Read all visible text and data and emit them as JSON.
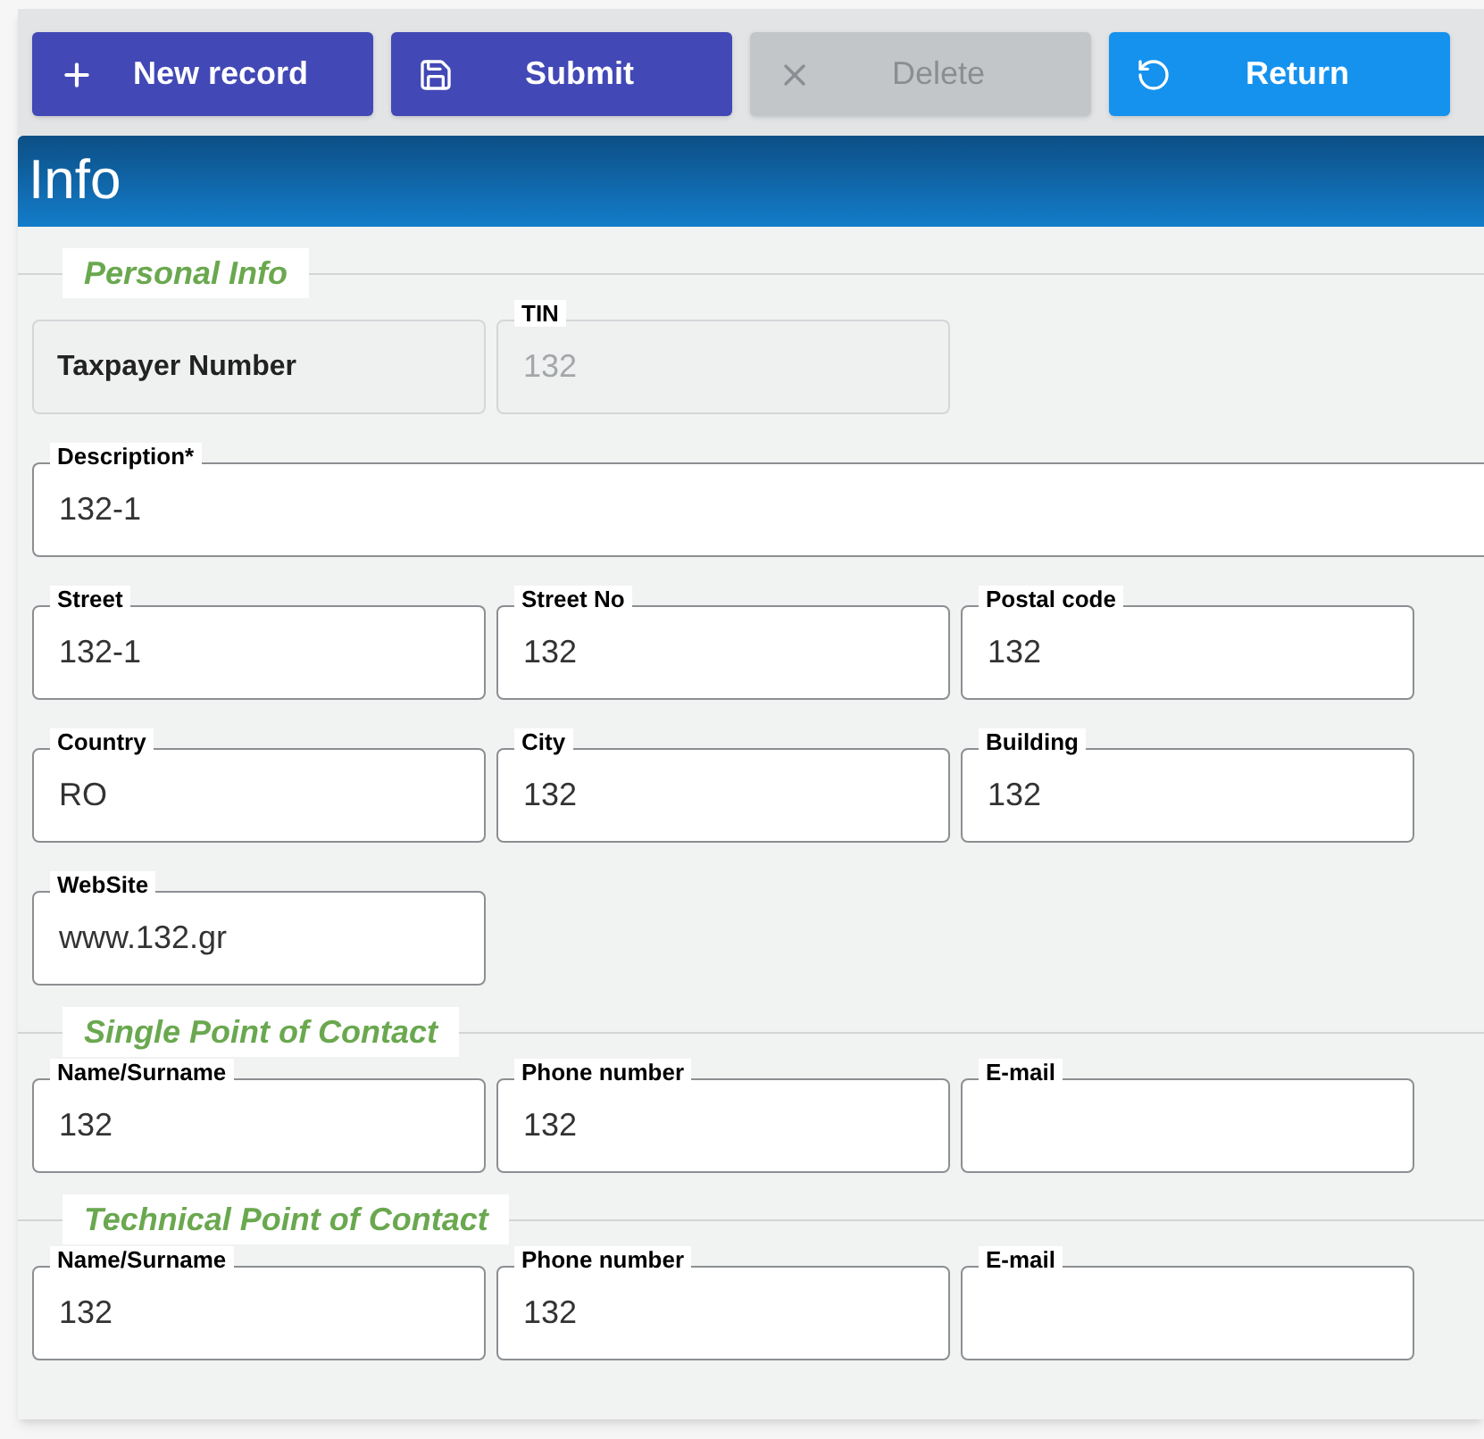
{
  "toolbar": [
    {
      "label": "New record",
      "kind": "add",
      "disabled": false
    },
    {
      "label": "Submit",
      "kind": "save",
      "disabled": false
    },
    {
      "label": "Delete",
      "kind": "delete",
      "disabled": true
    },
    {
      "label": "Return",
      "kind": "return",
      "disabled": false
    }
  ],
  "header": {
    "title": "Info"
  },
  "sections": [
    {
      "title": "Personal Info",
      "rows": [
        [
          {
            "kind": "static",
            "label": "Taxpayer Number"
          },
          {
            "kind": "field",
            "label": "TIN",
            "value": "132",
            "disabled": true
          }
        ],
        [
          {
            "kind": "wide-field",
            "label": "Description*",
            "value": "132-1",
            "disabled": false
          }
        ],
        [
          {
            "kind": "field",
            "label": "Street",
            "value": "132-1",
            "disabled": false
          },
          {
            "kind": "field",
            "label": "Street No",
            "value": "132",
            "disabled": false
          },
          {
            "kind": "field",
            "label": "Postal code",
            "value": "132",
            "disabled": false
          }
        ],
        [
          {
            "kind": "field",
            "label": "Country",
            "value": "RO",
            "disabled": false
          },
          {
            "kind": "field",
            "label": "City",
            "value": "132",
            "disabled": false
          },
          {
            "kind": "field",
            "label": "Building",
            "value": "132",
            "disabled": false
          }
        ],
        [
          {
            "kind": "field",
            "label": "WebSite",
            "value": "www.132.gr",
            "disabled": false
          }
        ]
      ]
    },
    {
      "title": "Single Point of Contact",
      "rows": [
        [
          {
            "kind": "field",
            "label": "Name/Surname",
            "value": "132",
            "disabled": false
          },
          {
            "kind": "field",
            "label": "Phone number",
            "value": "132",
            "disabled": false
          },
          {
            "kind": "field",
            "label": "E-mail",
            "disabled": false
          }
        ]
      ]
    },
    {
      "title": "Technical Point of Contact",
      "rows": [
        [
          {
            "kind": "field",
            "label": "Name/Surname",
            "value": "132",
            "disabled": false
          },
          {
            "kind": "field",
            "label": "Phone number",
            "value": "132",
            "disabled": false
          },
          {
            "kind": "field",
            "label": "E-mail",
            "disabled": false
          }
        ]
      ]
    }
  ]
}
